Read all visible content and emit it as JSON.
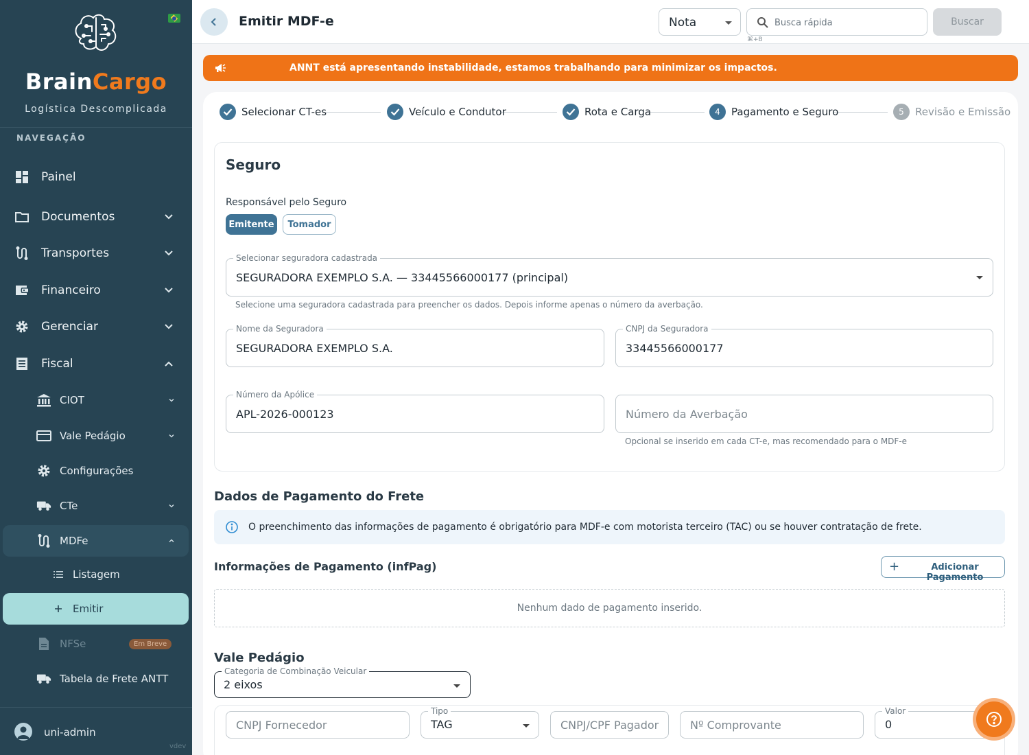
{
  "sidebar": {
    "brand_part1": "Brain",
    "brand_part2": "Cargo",
    "tagline": "Logística Descomplicada",
    "nav_heading": "NAVEGAÇÃO",
    "items": {
      "painel": "Painel",
      "documentos": "Documentos",
      "transportes": "Transportes",
      "financeiro": "Financeiro",
      "gerenciar": "Gerenciar",
      "fiscal": "Fiscal"
    },
    "fiscal_sub": {
      "ciot": "CIOT",
      "vale_pedagio": "Vale Pedágio",
      "configuracoes": "Configurações",
      "cte": "CTe",
      "mdfe": "MDFe",
      "listagem": "Listagem",
      "emitir": "Emitir",
      "nfse": "NFSe",
      "nfse_badge": "Em Breve",
      "tabela_frete": "Tabela de Frete ANTT"
    },
    "user_name": "uni-admin",
    "version": "vdev"
  },
  "topbar": {
    "title": "Emitir MDF-e",
    "doc_select": "Nota",
    "search_placeholder": "Busca rápida",
    "shortcut": "⌘+B",
    "search_button": "Buscar"
  },
  "alert": {
    "text": "ANNT está apresentando instabilidade, estamos trabalhando para minimizar os impactos.",
    "color": "#ef7317"
  },
  "stepper": {
    "steps": [
      {
        "num": "1",
        "label": "Selecionar CT-es",
        "state": "done"
      },
      {
        "num": "2",
        "label": "Veículo e Condutor",
        "state": "done"
      },
      {
        "num": "3",
        "label": "Rota e Carga",
        "state": "done"
      },
      {
        "num": "4",
        "label": "Pagamento e Seguro",
        "state": "active"
      },
      {
        "num": "5",
        "label": "Revisão e Emissão",
        "state": "pending"
      }
    ]
  },
  "seguro": {
    "title": "Seguro",
    "responsavel_label": "Responsável pelo Seguro",
    "option_emitente": "Emitente",
    "option_tomador": "Tomador",
    "selected": "Emitente",
    "seguradora_select_label": "Selecionar seguradora cadastrada",
    "seguradora_select_value": "SEGURADORA EXEMPLO S.A. — 33445566000177 (principal)",
    "seguradora_select_help": "Selecione uma seguradora cadastrada para preencher os dados. Depois informe apenas o número da averbação.",
    "nome_label": "Nome da Seguradora",
    "nome_value": "SEGURADORA EXEMPLO S.A.",
    "cnpj_label": "CNPJ da Seguradora",
    "cnpj_value": "33445566000177",
    "apolice_label": "Número da Apólice",
    "apolice_value": "APL-2026-000123",
    "averbacao_placeholder": "Número da Averbação",
    "averbacao_help": "Opcional se inserido em cada CT-e, mas recomendado para o MDF-e"
  },
  "pagamento": {
    "title": "Dados de Pagamento do Frete",
    "info": "O preenchimento das informações de pagamento é obrigatório para MDF-e com motorista terceiro (TAC) ou se houver contratação de frete.",
    "infpag_title": "Informações de Pagamento (infPag)",
    "add_button": "Adicionar Pagamento",
    "empty_text": "Nenhum dado de pagamento inserido."
  },
  "vale_pedagio": {
    "title": "Vale Pedágio",
    "categoria_label": "Categoria de Combinação Veicular",
    "categoria_value": "2 eixos",
    "cnpj_fornecedor_placeholder": "CNPJ Fornecedor",
    "tipo_label": "Tipo",
    "tipo_value": "TAG",
    "cnpj_pagador_placeholder": "CNPJ/CPF Pagador",
    "comprovante_placeholder": "Nº Comprovante",
    "valor_label": "Valor",
    "valor_value": "0"
  },
  "help_fab_icon": "question-circle-icon",
  "colors": {
    "sidebar_bg": "#274453",
    "accent": "#3f7395",
    "brand_orange": "#f07a1d",
    "active_leaf": "#a7dcdc"
  }
}
